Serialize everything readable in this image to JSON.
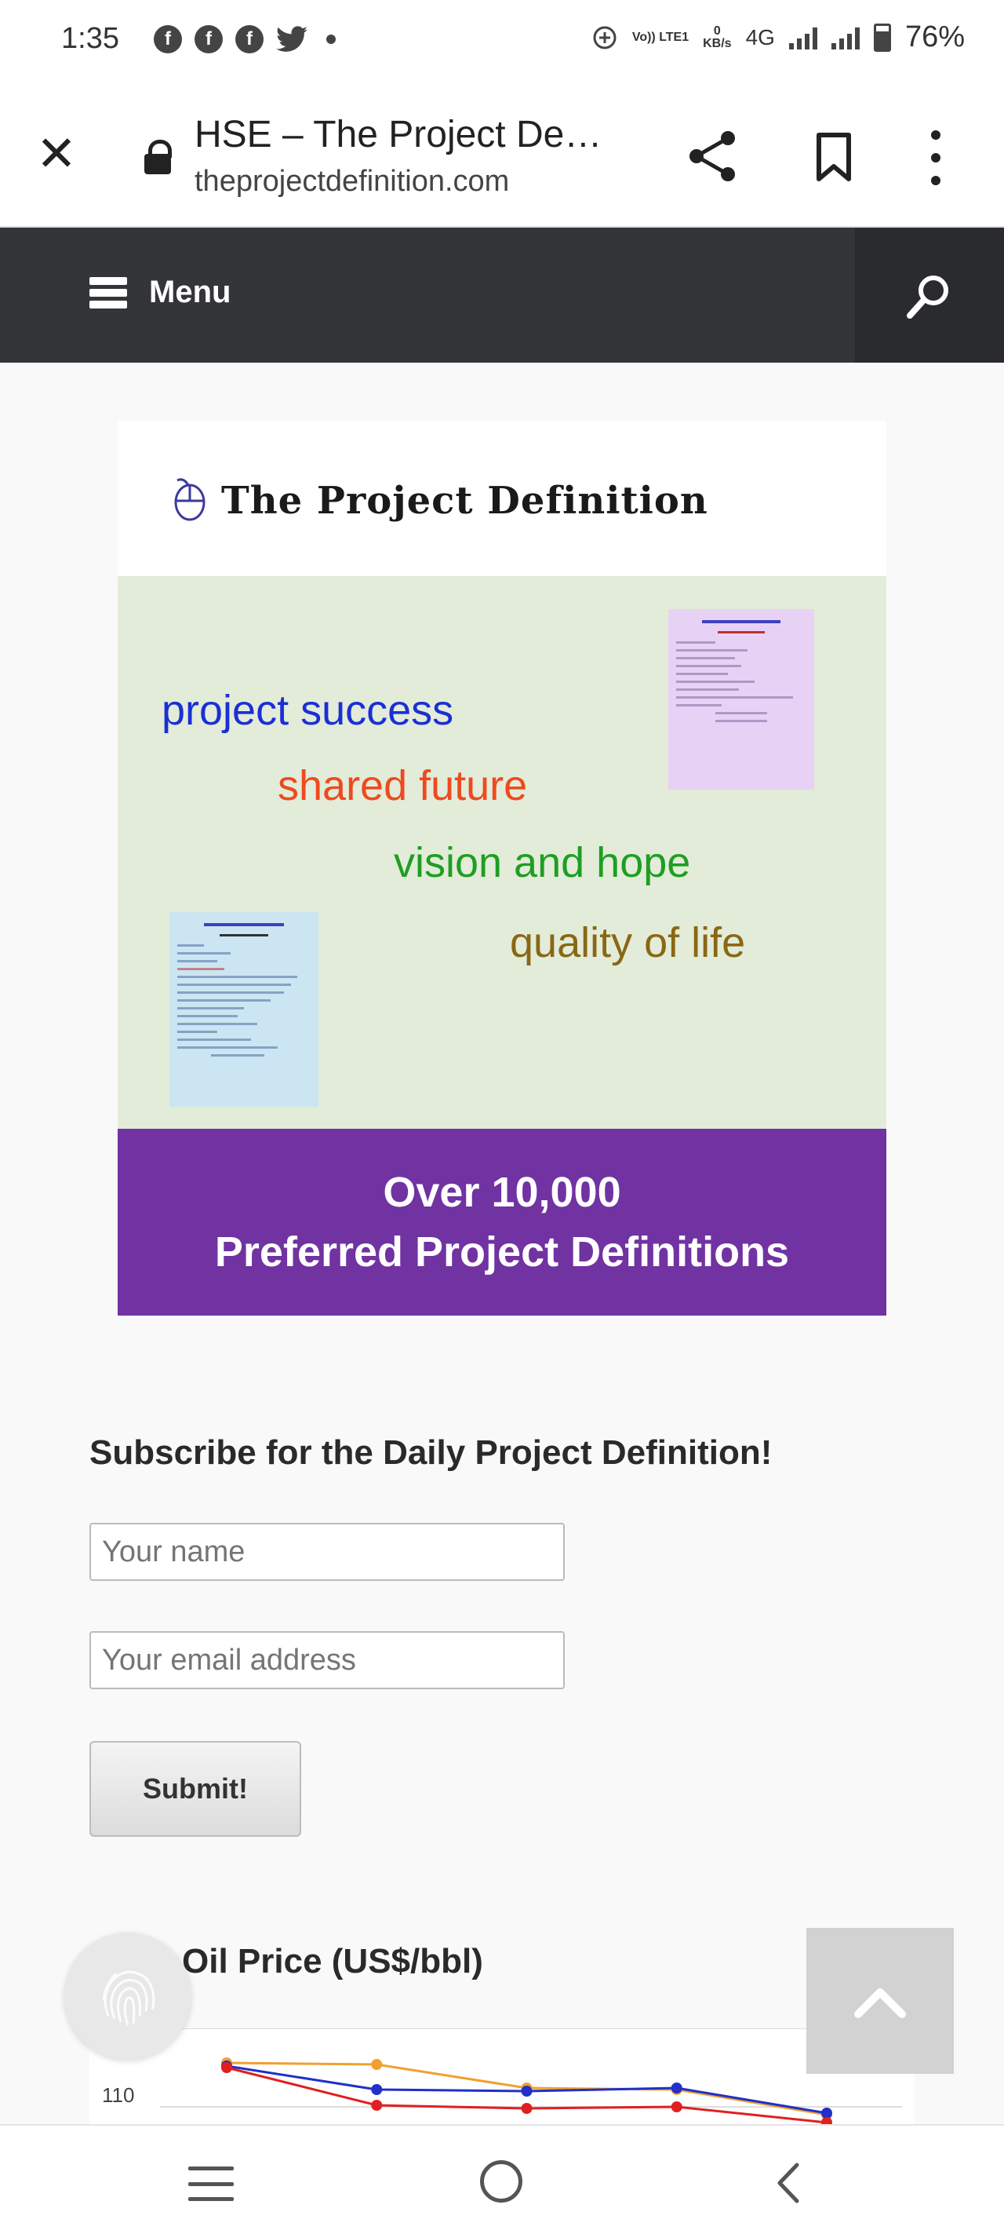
{
  "status_bar": {
    "time": "1:35",
    "left_icons": [
      "facebook-icon",
      "facebook-icon",
      "facebook-icon",
      "twitter-icon",
      "dot-icon"
    ],
    "volte": "Vo)) LTE1",
    "data_rate_value": "0",
    "data_rate_unit": "KB/s",
    "network": "4G",
    "battery": "76%"
  },
  "browser": {
    "page_title": "HSE – The Project De…",
    "url": "theprojectdefinition.com"
  },
  "site_nav": {
    "menu_label": "Menu"
  },
  "banner": {
    "site_title": "The Project Definition",
    "slogans": [
      "project success",
      "shared future",
      "vision and hope",
      "quality of life"
    ],
    "bottom_line1": "Over 10,000",
    "bottom_line2": "Preferred Project Definitions",
    "colors": {
      "top": "#ffffff",
      "middle": "#e2ecd9",
      "bottom": "#7132a2",
      "slogan1": "#1b2fd6",
      "slogan2": "#ee4a1f",
      "slogan3": "#1e9e22",
      "slogan4": "#8a6714"
    }
  },
  "subscribe": {
    "heading": "Subscribe for the Daily Project Definition!",
    "name_placeholder": "Your name",
    "email_placeholder": "Your email address",
    "submit_label": "Submit!"
  },
  "oil_price": {
    "heading": "Oil Price (US$/bbl)",
    "chart_data": {
      "type": "line",
      "title": "Oil Price (US$/bbl)",
      "x": [
        1,
        2,
        3,
        4,
        5
      ],
      "series": [
        {
          "color": "#f0a030",
          "values": [
            112.8,
            112.7,
            111.2,
            111.1,
            109.5
          ]
        },
        {
          "color": "#2030c8",
          "values": [
            112.6,
            111.1,
            111.0,
            111.2,
            109.6
          ]
        },
        {
          "color": "#e02020",
          "values": [
            112.5,
            110.1,
            109.9,
            110.0,
            109.0
          ]
        }
      ],
      "yticks": [
        "110"
      ],
      "ylim": [
        108.5,
        116
      ],
      "grid": true
    }
  }
}
